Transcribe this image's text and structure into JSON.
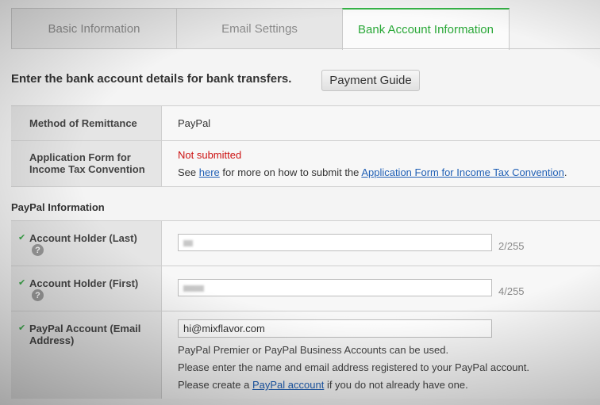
{
  "tabs": [
    {
      "label": "Basic Information"
    },
    {
      "label": "Email Settings"
    },
    {
      "label": "Bank Account Information"
    }
  ],
  "lead": "Enter the bank account details for bank transfers.",
  "payment_guide_button": "Payment Guide",
  "info": {
    "method_label": "Method of Remittance",
    "method_value": "PayPal",
    "form_label_line1": "Application Form for",
    "form_label_line2": "Income Tax Convention",
    "form_status": "Not submitted",
    "form_see": "See",
    "form_here_link": "here",
    "form_mid": "for more on how to submit the",
    "form_app_link": "Application Form for Income Tax Convention",
    "form_end": "."
  },
  "paypal": {
    "section_title": "PayPal Information",
    "last_label": "Account Holder (Last)",
    "last_counter": "2/255",
    "first_label": "Account Holder (First)",
    "first_counter": "4/255",
    "email_label_line1": "PayPal Account (Email",
    "email_label_line2": "Address)",
    "email_value": "hi@mixflavor.com",
    "note1": "PayPal Premier or PayPal Business Accounts can be used.",
    "note2": "Please enter the name and email address registered to your PayPal account.",
    "note3_pre": "Please create a",
    "note3_link": "PayPal account",
    "note3_post": "if you do not already have one."
  },
  "colors": {
    "active_tab": "#2aa838",
    "link": "#1f5fb5",
    "status_red": "#cc1111",
    "check_green": "#3aa648"
  },
  "icons": {
    "check": "check-icon",
    "help": "help-icon"
  }
}
